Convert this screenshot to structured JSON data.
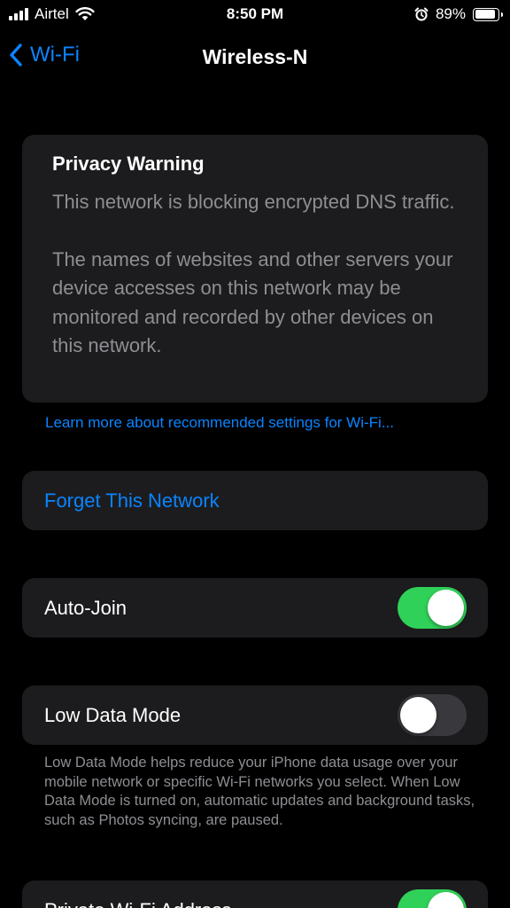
{
  "status_bar": {
    "carrier": "Airtel",
    "time": "8:50 PM",
    "battery_percent_label": "89%",
    "battery_level": 0.89,
    "icons": [
      "signal-icon",
      "wifi-icon",
      "alarm-icon",
      "battery-icon"
    ]
  },
  "nav": {
    "back_label": "Wi-Fi",
    "title": "Wireless-N"
  },
  "privacy_warning": {
    "title": "Privacy Warning",
    "paragraph1": "This network is blocking encrypted DNS traffic.",
    "paragraph2": "The names of websites and other servers your device accesses on this network may be monitored and recorded by other devices on this network."
  },
  "learn_more_link": "Learn more about recommended settings for Wi-Fi...",
  "forget_network": "Forget This Network",
  "auto_join": {
    "label": "Auto-Join",
    "enabled": true
  },
  "low_data_mode": {
    "label": "Low Data Mode",
    "enabled": false,
    "footnote": "Low Data Mode helps reduce your iPhone data usage over your mobile network or specific Wi-Fi networks you select. When Low Data Mode is turned on, automatic updates and background tasks, such as Photos syncing, are paused."
  },
  "private_address": {
    "label": "Private Wi-Fi Address",
    "enabled": true
  },
  "colors": {
    "accent": "#0a84ff",
    "toggle_on": "#30d158",
    "toggle_off": "#39393d",
    "card": "#1c1c1e",
    "secondary_text": "#8e8e93"
  }
}
